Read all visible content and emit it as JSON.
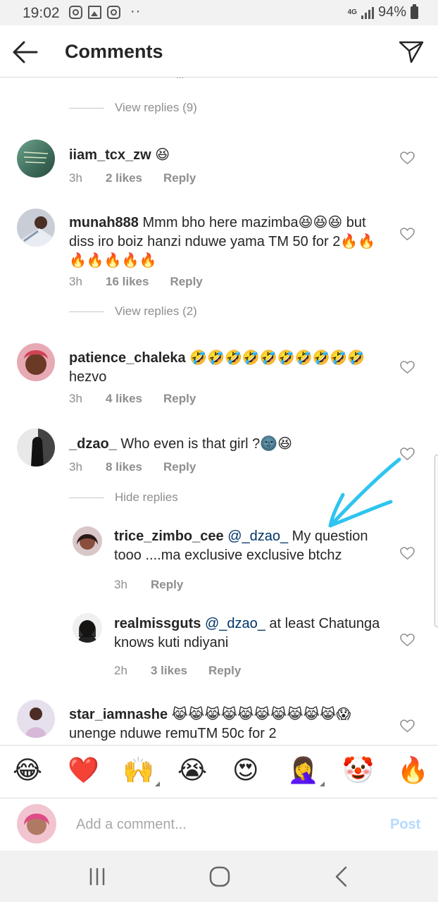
{
  "status_bar": {
    "time": "19:02",
    "network": "4G",
    "battery": "94%"
  },
  "header": {
    "title": "Comments"
  },
  "partial_text": "...",
  "threads": [
    {
      "view_replies": "View replies (9)"
    },
    {
      "user": "iiam_tcx_zw",
      "text": " 😆",
      "time": "3h",
      "likes": "2 likes",
      "reply": "Reply"
    },
    {
      "user": "munah888",
      "text": " Mmm bho here mazimba😆😆😆 but diss iro boiz hanzi nduwe yama TM 50 for 2🔥🔥🔥🔥🔥🔥🔥",
      "time": "3h",
      "likes": "16 likes",
      "reply": "Reply"
    },
    {
      "view_replies": "View replies (2)"
    },
    {
      "user": "patience_chaleka",
      "text": " 🤣🤣🤣🤣🤣🤣🤣🤣🤣🤣 hezvo",
      "time": "3h",
      "likes": "4 likes",
      "reply": "Reply"
    },
    {
      "user": "_dzao_",
      "text": " Who even is that girl ?🌚😆",
      "time": "3h",
      "likes": "8 likes",
      "reply": "Reply"
    },
    {
      "hide_replies": "Hide replies"
    },
    {
      "user": "trice_zimbo_cee",
      "mention": " @_dzao_",
      "text": " My question tooo ....ma exclusive exclusive btchz",
      "time": "3h",
      "reply": "Reply"
    },
    {
      "user": "realmissguts",
      "mention": " @_dzao_",
      "text": " at least Chatunga knows kuti ndiyani",
      "time": "2h",
      "likes": "3 likes",
      "reply": "Reply"
    },
    {
      "user": "star_iamnashe",
      "text": " 😹😹😹😹😹😹😹😹😹😹😱 unenge nduwe remuTM 50c for 2"
    }
  ],
  "emoji_bar": [
    "😂",
    "❤️",
    "🙌",
    "😭",
    "😍",
    "🤦‍♀️",
    "🤡",
    "🔥"
  ],
  "composer": {
    "placeholder": "Add a comment...",
    "post_label": "Post"
  },
  "colors": {
    "mention": "#003569",
    "post_disabled": "#b3dbff",
    "muted": "#8e8e8e"
  }
}
